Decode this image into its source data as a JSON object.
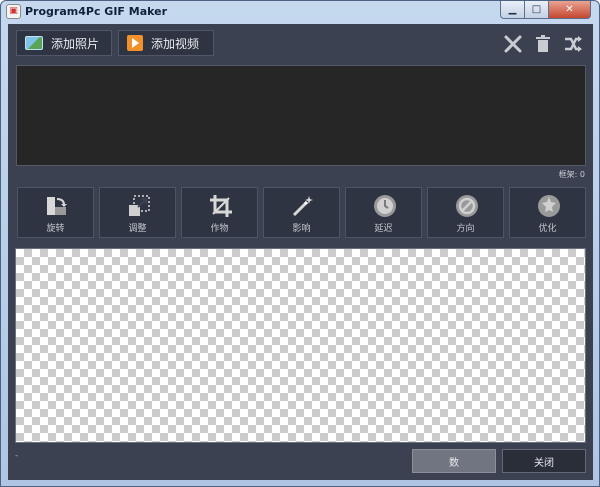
{
  "window": {
    "title": "Program4Pc GIF Maker",
    "controls": {
      "minimize": "▁",
      "maximize": "□",
      "close": "✕"
    }
  },
  "toolbar": {
    "add_photo_label": "添加照片",
    "add_video_label": "添加视频",
    "delete_icon": "✕",
    "trash_icon": "🗑",
    "shuffle_icon": "⤨"
  },
  "image_list": {
    "frames_label": "框架: 0"
  },
  "tools": [
    {
      "label": "旋转",
      "icon": "rotate-icon"
    },
    {
      "label": "调整",
      "icon": "resize-icon"
    },
    {
      "label": "作物",
      "icon": "crop-icon"
    },
    {
      "label": "影响",
      "icon": "magic-wand-icon"
    },
    {
      "label": "延迟",
      "icon": "clock-icon"
    },
    {
      "label": "方向",
      "icon": "direction-icon"
    },
    {
      "label": "优化",
      "icon": "optimize-icon"
    }
  ],
  "footer": {
    "status_dot": "-",
    "save_label": "数",
    "close_label": "关闭"
  },
  "colors": {
    "client_bg": "#3b4151",
    "button_bg": "#2f3442",
    "list_bg": "#262626",
    "accent_orange": "#f0912b"
  }
}
